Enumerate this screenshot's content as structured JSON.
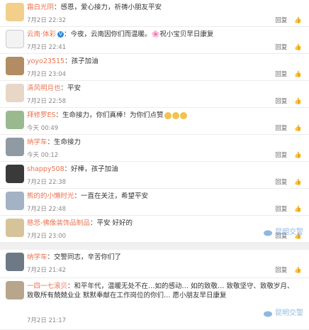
{
  "comments": [
    {
      "name": "霜白光阴",
      "text": "：感恩，爱心接力，祈祷小朋友平安",
      "time": "7月2日 22:32",
      "reply": "回复",
      "likes": "ഥ"
    },
    {
      "name": "云南·体彩",
      "text": "：今夜，云南因你们而温暖。🌸祝小宝贝早日康复",
      "time": "7月2日 22:41",
      "reply": "回复",
      "likes": "ഥ"
    },
    {
      "name": "yoyo23515",
      "text": "：孩子加油",
      "time": "7月2日 23:04",
      "reply": "回复",
      "likes": "ഥ"
    },
    {
      "name": "清风明月也",
      "text": "：平安",
      "time": "7月2日 22:58",
      "reply": "回复",
      "likes": "ഥ"
    },
    {
      "name": "拜修罗ES",
      "text": "：生命接力，你们真棒！为你们点赞",
      "time": "今天 00:49",
      "reply": "回复",
      "likes": "ഥ"
    },
    {
      "name": "纳学车",
      "text": "：生命接力",
      "time": "今天 00:12",
      "reply": "回复",
      "likes": "ഥ"
    },
    {
      "name": "shappy508",
      "text": "：好棒，孩子加油",
      "time": "7月2日 22:38",
      "reply": "回复",
      "likes": "ഥ"
    },
    {
      "name": "熊的的小懒时光",
      "text": "：一直在关注，希望平安",
      "time": "7月2日 22:48",
      "reply": "回复",
      "likes": "ഥ"
    },
    {
      "name": "慈悲-佛像装饰品制品",
      "text": "：平安 好好的",
      "time": "7月2日 23:00",
      "reply": "回复",
      "likes": "ഥ"
    },
    {
      "name": "纳学车",
      "text": "：交警同志，辛苦你们了",
      "time": "7月2日 21:42",
      "reply": "回复",
      "likes": "ഥ"
    },
    {
      "name": "一四一七滚贝",
      "text": "：和平年代，温暖无处不在…如的感动… 如的致敬… 致敬坚守、致敬岁月、致敬所有兢兢业业 默默奉献在工作岗位的你们… 愿小朋友早日康复",
      "time": "7月2日 21:17",
      "reply": "回复",
      "likes": "ഥ"
    }
  ],
  "watermark": "昆明交警",
  "icons": {
    "verified": "verified-badge-icon",
    "thumb": "thumbs-up-icon",
    "weibo": "weibo-logo-icon"
  }
}
